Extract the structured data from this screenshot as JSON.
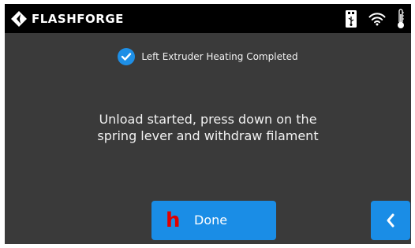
{
  "topbar": {
    "brand": "FLASHFORGE",
    "icons": [
      "flashforge-logo-icon",
      "usb-drive-icon",
      "wifi-icon",
      "thermometer-icon"
    ]
  },
  "notice": {
    "icon": "checkmark-circle-icon",
    "text": "Left Extruder Heating Completed"
  },
  "message": {
    "line1": "Unload started, press down on the",
    "line2": "spring lever and withdraw filament"
  },
  "buttons": {
    "done_mark": "h",
    "done_label": "Done",
    "back_icon": "chevron-left-icon"
  },
  "colors": {
    "accent": "#1a8de6",
    "background": "#3a3a3a",
    "topbar": "#000000",
    "mark": "#e00000"
  }
}
